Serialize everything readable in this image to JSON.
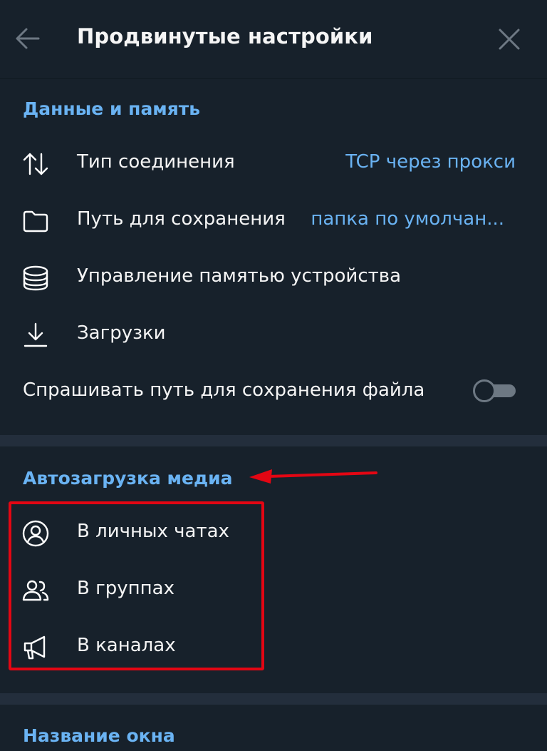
{
  "header": {
    "title": "Продвинутые настройки",
    "back_icon": "arrow-left-icon",
    "close_icon": "close-icon"
  },
  "data_memory": {
    "section_title": "Данные и память",
    "items": [
      {
        "label": "Тип соединения",
        "value": "TCP через прокси",
        "icon": "arrows-up-down-icon"
      },
      {
        "label": "Путь для сохранения",
        "value": "папка по умолчан...",
        "icon": "folder-icon"
      },
      {
        "label": "Управление памятью устройства",
        "icon": "database-icon"
      },
      {
        "label": "Загрузки",
        "icon": "download-icon"
      }
    ],
    "ask_path": {
      "label": "Спрашивать путь для сохранения файла",
      "enabled": false
    }
  },
  "autodownload": {
    "section_title": "Автозагрузка медиа",
    "items": [
      {
        "label": "В личных чатах",
        "icon": "user-circle-icon"
      },
      {
        "label": "В группах",
        "icon": "users-icon"
      },
      {
        "label": "В каналах",
        "icon": "megaphone-icon"
      }
    ]
  },
  "window_title": {
    "section_title": "Название окна"
  },
  "colors": {
    "background": "#17212b",
    "divider": "#232e3c",
    "accent": "#6ab3f3",
    "text": "#f5f5f5",
    "icon": "#ffffff",
    "annotation": "#e30613"
  }
}
